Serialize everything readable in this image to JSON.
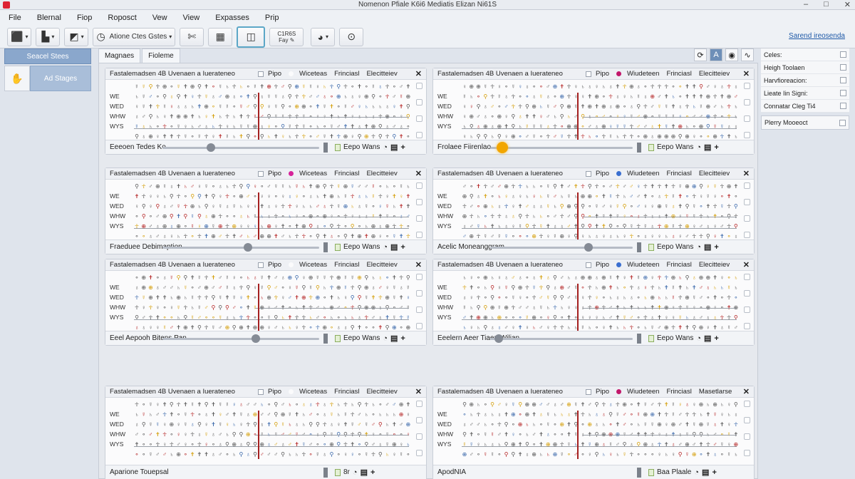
{
  "window": {
    "title": "Nomenon Pfiale K6i6 Mediatis Elizan Ni61S"
  },
  "menu": [
    "File",
    "Blernal",
    "Fiop",
    "Roposct",
    "Vew",
    "View",
    "Expasses",
    "Prip"
  ],
  "toolbar": {
    "combo_label": "Atione Ctes Gstes",
    "stack_top": "C1R6S",
    "stack_bottom": "Fay",
    "link": "Sarend ireosenda"
  },
  "left_panel": {
    "header": "Seacel Stees",
    "button": "Ad Stages"
  },
  "tabs": [
    "Magnaes",
    "Fioleme"
  ],
  "right_panel": {
    "items": [
      "Celes:",
      "Heigh Toolaen",
      "Harvfioreacion:",
      "Lieate Iin Signi:",
      "Connatar Cleg Ti4"
    ],
    "last_item": "Plerry Mooeoct"
  },
  "row_labels": [
    "",
    "WE",
    "WED",
    "WHW",
    "WYS"
  ],
  "panels": [
    {
      "hdr_title": "Fastalemadsen 4B Uvenaen a Iuerateneo",
      "col1": "Pipo",
      "dot": "",
      "col2": "Wiceteas",
      "col3": "Frinciasl",
      "col4": "Elecitteiev",
      "footer": "Eeeoen Tedes Ko",
      "knob": 0.3,
      "knob_color": "gray",
      "status": "Eepo Wans"
    },
    {
      "hdr_title": "Fastalemadsen 4B Uvenaen a Iuerateneo",
      "col1": "Pipo",
      "dot": "#c2186b",
      "col2": "Wiudeteen",
      "col3": "Frinciasl",
      "col4": "Elecitteiev",
      "footer": "Frolaee Fiirenlao",
      "knob": 0.05,
      "knob_color": "orange",
      "status": "Eepo Wans"
    },
    {
      "hdr_title": "Fastalemadsen 4B Uvenaen a Iuerateneo",
      "col1": "Pipo",
      "dot": "#d6249a",
      "col2": "Wiceteas",
      "col3": "Frinciasl",
      "col4": "Elecitteiev",
      "footer": "Fraeduee Debimaption",
      "knob": 0.55,
      "knob_color": "gray",
      "status": "Eepo Wans"
    },
    {
      "hdr_title": "Fastalemadsen 4B Uvenaen a Iuerateneo",
      "col1": "Pipo",
      "dot": "#3a6fd0",
      "col2": "Wiudeteen",
      "col3": "Frinciasl",
      "col4": "Elecitteiev",
      "footer": "Acelic Moneanggram",
      "knob": 0.7,
      "knob_color": "gray",
      "status": "Eepo Wans"
    },
    {
      "hdr_title": "Fastalemadsen 4B Uvenaen a Iuerateneo",
      "col1": "Pipo",
      "dot": "",
      "col2": "Wiceteas",
      "col3": "Frinciasl",
      "col4": "Elecitteiev",
      "footer": "Eeel Aepooh Bitens Pan",
      "knob": 0.6,
      "knob_color": "gray",
      "status": "Eepo Wans"
    },
    {
      "hdr_title": "Fastalemadsen 4B Uvenaen a Iuerateneo",
      "col1": "Pipo",
      "dot": "#3a6fd0",
      "col2": "Wiudeteen",
      "col3": "Frinciasl",
      "col4": "Elecitteiev",
      "footer": "Eeelern Aeer Tiaen Wilian",
      "knob": 0.03,
      "knob_color": "gray",
      "status": "Eepo Wans"
    },
    {
      "hdr_title": "Fastalemadsen 4B Uvenaen a Iuerateneo",
      "col1": "Pipo",
      "dot": "",
      "col2": "Wiceteas",
      "col3": "Frinciasl",
      "col4": "Elecitteiev",
      "footer": "Aparione Touepsal",
      "knob": 0,
      "knob_color": "none",
      "status": "8r"
    },
    {
      "hdr_title": "Fastalemadsen 4B Uvenaen a Iuerateneo",
      "col1": "Pipo",
      "dot": "#c2186b",
      "col2": "Wiudeteen",
      "col3": "Frinciasl",
      "col4": "Masetlarse",
      "footer": "ApodNIA",
      "knob": 0,
      "knob_color": "none",
      "status": "Baa Plaale"
    }
  ]
}
